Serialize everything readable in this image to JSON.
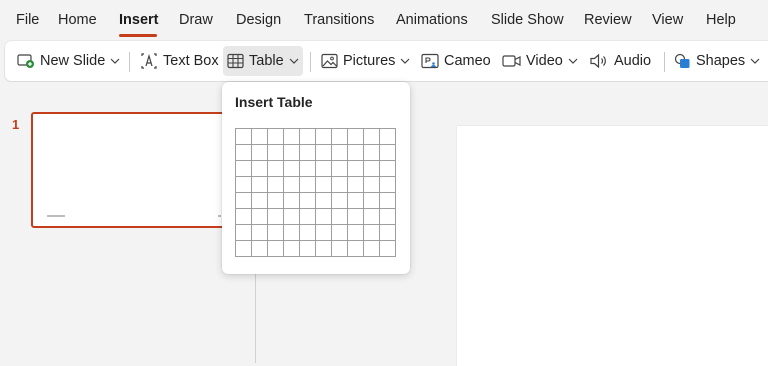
{
  "menu": {
    "tabs": [
      {
        "label": "File"
      },
      {
        "label": "Home"
      },
      {
        "label": "Insert",
        "active": true
      },
      {
        "label": "Draw"
      },
      {
        "label": "Design"
      },
      {
        "label": "Transitions"
      },
      {
        "label": "Animations"
      },
      {
        "label": "Slide Show"
      },
      {
        "label": "Review"
      },
      {
        "label": "View"
      },
      {
        "label": "Help"
      }
    ]
  },
  "ribbon": {
    "new_slide": "New Slide",
    "text_box": "Text Box",
    "table": "Table",
    "pictures": "Pictures",
    "cameo": "Cameo",
    "video": "Video",
    "audio": "Audio",
    "shapes": "Shapes"
  },
  "dropdown": {
    "title": "Insert Table",
    "grid_rows": 8,
    "grid_cols": 10
  },
  "slides": {
    "current_number": "1"
  },
  "colors": {
    "accent": "#c43e1c",
    "background": "#f3f3f3",
    "ribbon": "#ffffff"
  }
}
